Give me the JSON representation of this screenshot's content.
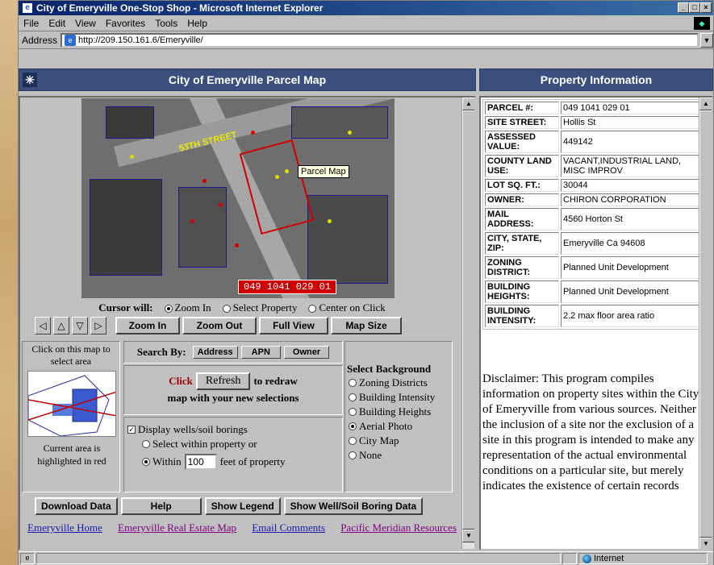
{
  "window": {
    "title": "City of Emeryville One-Stop Shop - Microsoft Internet Explorer",
    "controls": [
      "_",
      "□",
      "×"
    ]
  },
  "menu": [
    "File",
    "Edit",
    "View",
    "Favorites",
    "Tools",
    "Help"
  ],
  "address": {
    "label": "Address",
    "url": "http://209.150.161.6/Emeryville/"
  },
  "left_header": {
    "title": "City of Emeryville Parcel Map"
  },
  "right_header": {
    "title": "Property Information"
  },
  "map": {
    "tooltip": "Parcel Map",
    "street_label": "53TH STREET",
    "parcel_label": "049  1041 029 01"
  },
  "cursor": {
    "label": "Cursor will:",
    "options": [
      {
        "label": "Zoom In",
        "selected": true
      },
      {
        "label": "Select Property",
        "selected": false
      },
      {
        "label": "Center on Click",
        "selected": false
      }
    ]
  },
  "toolbar": {
    "zoom_in": "Zoom In",
    "zoom_out": "Zoom Out",
    "full_view": "Full View",
    "map_size": "Map Size",
    "nav": [
      "◁",
      "△",
      "▽",
      "▷"
    ]
  },
  "locator": {
    "caption_top": "Click on this map to select area",
    "caption_bottom": "Current area is highlighted in red"
  },
  "search": {
    "label": "Search By:",
    "buttons": [
      "Address",
      "APN",
      "Owner"
    ]
  },
  "refresh": {
    "click": "Click",
    "button": "Refresh",
    "after": "to redraw",
    "line2": "map with your new selections"
  },
  "wells": {
    "checkbox_label": "Display wells/soil borings",
    "checked": true,
    "option1": "Select within property or",
    "option2_prefix": "Within",
    "distance": "100",
    "option2_suffix": "feet of property",
    "selected_option": 2
  },
  "background": {
    "title": "Select Background",
    "options": [
      {
        "label": "Zoning Districts",
        "selected": false
      },
      {
        "label": "Building Intensity",
        "selected": false
      },
      {
        "label": "Building Heights",
        "selected": false
      },
      {
        "label": "Aerial Photo",
        "selected": true
      },
      {
        "label": "City Map",
        "selected": false
      },
      {
        "label": "None",
        "selected": false
      }
    ]
  },
  "bottom_buttons": [
    "Download Data",
    "Help",
    "Show Legend",
    "Show Well/Soil Boring Data"
  ],
  "links": [
    "Emeryville Home",
    "Emeryville Real Estate Map",
    "Email Comments",
    "Pacific Meridian Resources"
  ],
  "property": [
    {
      "key": "PARCEL #:",
      "value": "049 1041 029 01"
    },
    {
      "key": "SITE STREET:",
      "value": "Hollis St"
    },
    {
      "key": "ASSESSED VALUE:",
      "value": "449142"
    },
    {
      "key": "COUNTY LAND USE:",
      "value": "VACANT,INDUSTRIAL LAND, MISC IMPROV"
    },
    {
      "key": "LOT SQ. FT.:",
      "value": "30044"
    },
    {
      "key": "OWNER:",
      "value": "CHIRON CORPORATION"
    },
    {
      "key": "MAIL ADDRESS:",
      "value": "4560 Horton St"
    },
    {
      "key": "CITY, STATE, ZIP:",
      "value": "Emeryville Ca 94608"
    },
    {
      "key": "ZONING DISTRICT:",
      "value": "Planned Unit Development"
    },
    {
      "key": "BUILDING HEIGHTS:",
      "value": "Planned Unit Development"
    },
    {
      "key": "BUILDING INTENSITY:",
      "value": "2.2 max floor area ratio"
    }
  ],
  "disclaimer": "Disclaimer: This program compiles information on property sites within the City of Emeryville from various sources. Neither the inclusion of a site nor the exclusion of a site in this program is intended to make any representation of the actual environmental conditions on a particular site, but merely indicates the existence of certain records",
  "status": {
    "zone": "Internet"
  }
}
